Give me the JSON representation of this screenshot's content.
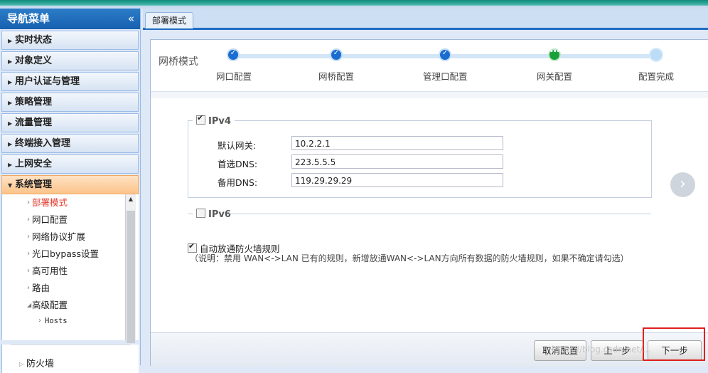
{
  "sidebar": {
    "title": "导航菜单",
    "collapse_glyph": "«",
    "items": [
      {
        "label": "实时状态"
      },
      {
        "label": "对象定义"
      },
      {
        "label": "用户认证与管理"
      },
      {
        "label": "策略管理"
      },
      {
        "label": "流量管理"
      },
      {
        "label": "终端接入管理"
      },
      {
        "label": "上网安全"
      },
      {
        "label": "系统管理"
      }
    ],
    "submenu": [
      {
        "label": "部署模式"
      },
      {
        "label": "网口配置"
      },
      {
        "label": "网络协议扩展"
      },
      {
        "label": "光口bypass设置"
      },
      {
        "label": "高可用性"
      },
      {
        "label": "路由"
      },
      {
        "label": "高级配置"
      },
      {
        "label": "Hosts"
      }
    ],
    "bottom_items": [
      {
        "label": "防火墙"
      }
    ]
  },
  "tabs": [
    {
      "label": "部署模式"
    }
  ],
  "wizard": {
    "title": "网桥模式",
    "steps": [
      {
        "label": "网口配置",
        "state": "done"
      },
      {
        "label": "网桥配置",
        "state": "done"
      },
      {
        "label": "管理口配置",
        "state": "done"
      },
      {
        "label": "网关配置",
        "state": "current"
      },
      {
        "label": "配置完成",
        "state": "todo"
      }
    ],
    "done_glyph": "✓",
    "current_glyph": "•••"
  },
  "ipv4": {
    "legend": "IPv4",
    "checked": true,
    "gateway_label": "默认网关:",
    "gateway_value": "10.2.2.1",
    "dns1_label": "首选DNS:",
    "dns1_value": "223.5.5.5",
    "dns2_label": "备用DNS:",
    "dns2_value": "119.29.29.29"
  },
  "ipv6": {
    "legend": "IPv6",
    "checked": false
  },
  "firewall_option": {
    "label": "自动放通防火墙规则",
    "checked": true,
    "note": "（说明：禁用 WAN<->LAN 已有的规则，新增放通WAN<->LAN方向所有数据的防火墙规则，如果不确定请勾选）"
  },
  "buttons": {
    "cancel": "取消配置",
    "prev": "上一步",
    "next": "下一步",
    "next_circle_glyph": "›"
  },
  "watermark": "https://blog.csdn.net/..."
}
